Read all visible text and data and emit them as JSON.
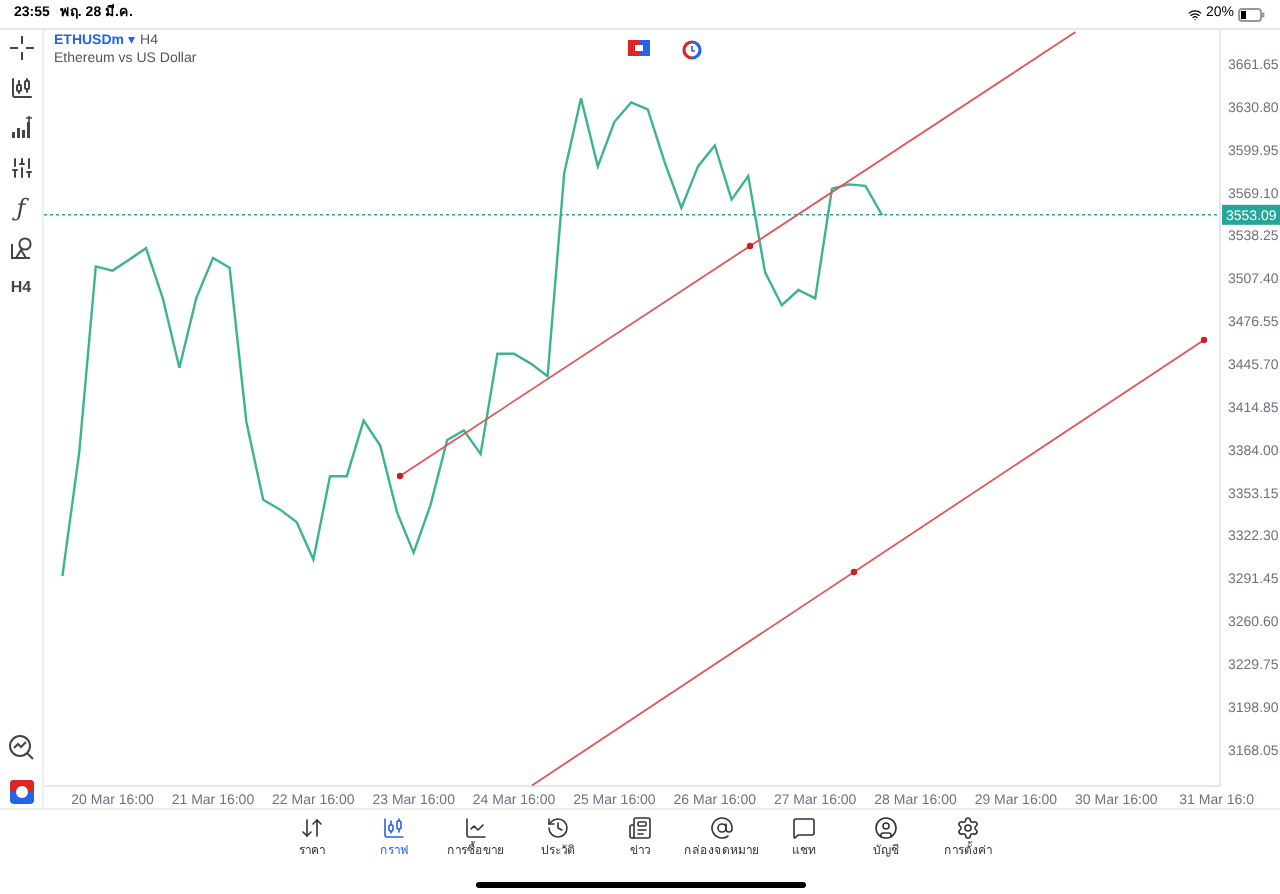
{
  "status_bar": {
    "time": "23:55",
    "date": "พฤ. 28 มี.ค.",
    "battery": "20%"
  },
  "toolbar": {
    "function_label": "ƒ",
    "timeframe": "H4"
  },
  "chart_header": {
    "symbol": "ETHUSDm",
    "marker": "▾",
    "timeframe": "H4",
    "description": "Ethereum vs US Dollar"
  },
  "chart": {
    "chart_data": {
      "type": "line",
      "categories": [
        null,
        null,
        null,
        "20 Mar 16:00",
        null,
        null,
        null,
        null,
        null,
        "21 Mar 16:00",
        null,
        null,
        null,
        null,
        null,
        "22 Mar 16:00",
        null,
        null,
        null,
        null,
        null,
        "23 Mar 16:00",
        null,
        null,
        null,
        null,
        null,
        "24 Mar 16:00",
        null,
        null,
        null,
        null,
        null,
        "25 Mar 16:00",
        null,
        null,
        null,
        null,
        null,
        "26 Mar 16:00",
        null,
        null,
        null,
        null,
        null,
        "27 Mar 16:00",
        null,
        null,
        null,
        null,
        null,
        "28 Mar 16:00",
        null,
        null,
        null,
        null,
        null,
        "29 Mar 16:00",
        null,
        null,
        null,
        null,
        null,
        "30 Mar 16:00",
        null,
        null,
        null,
        null,
        null,
        "31 Mar 16:0"
      ],
      "series": [
        {
          "color": "#3cb58d",
          "values": [
            3293,
            3382,
            3516,
            3513,
            3521,
            3529,
            3493,
            3443,
            3493,
            3522,
            3515,
            3404,
            3348,
            3341,
            3332,
            3305,
            3365,
            3365,
            3405,
            3387,
            3339,
            3310,
            3344,
            3391,
            3398,
            3381,
            3453,
            3453,
            3446,
            3437,
            3583,
            3637,
            3588,
            3620,
            3634,
            3629,
            3591,
            3558,
            3588,
            3603,
            3564,
            3581,
            3512,
            3488,
            3499,
            3493,
            3572,
            3575,
            3574,
            3553,
            null,
            null,
            null,
            null,
            null,
            null,
            null,
            null,
            null,
            null,
            null,
            null,
            null,
            null,
            null,
            null,
            null,
            null,
            null,
            null
          ]
        }
      ],
      "ylim": [
        3142.0,
        3686.1
      ],
      "yticks": [
        {
          "value": 3661.65,
          "label": "3661.65"
        },
        {
          "value": 3630.8,
          "label": "3630.80"
        },
        {
          "value": 3599.95,
          "label": "3599.95"
        },
        {
          "value": 3569.1,
          "label": "3569.10"
        },
        {
          "value": 3538.25,
          "label": "3538.25"
        },
        {
          "value": 3507.4,
          "label": "3507.40"
        },
        {
          "value": 3476.55,
          "label": "3476.55"
        },
        {
          "value": 3445.7,
          "label": "3445.70"
        },
        {
          "value": 3414.85,
          "label": "3414.85"
        },
        {
          "value": 3384.0,
          "label": "3384.00"
        },
        {
          "value": 3353.15,
          "label": "3353.15"
        },
        {
          "value": 3322.3,
          "label": "3322.30"
        },
        {
          "value": 3291.45,
          "label": "3291.45"
        },
        {
          "value": 3260.6,
          "label": "3260.60"
        },
        {
          "value": 3229.75,
          "label": "3229.75"
        },
        {
          "value": 3198.9,
          "label": "3198.90"
        },
        {
          "value": 3168.05,
          "label": "3168.05"
        }
      ],
      "ref_lines": [
        {
          "axis": "y",
          "value": 3553.09,
          "label": "3553.09",
          "color": "#26a69a"
        }
      ]
    }
  },
  "nav": [
    {
      "label": "ราคา",
      "selected": false
    },
    {
      "label": "กราฟ",
      "selected": true
    },
    {
      "label": "การซื้อขาย",
      "selected": false
    },
    {
      "label": "ประวัติ",
      "selected": false
    },
    {
      "label": "ข่าว",
      "selected": false
    },
    {
      "label": "กล่องจดหมาย",
      "selected": false
    },
    {
      "label": "แชท",
      "selected": false
    },
    {
      "label": "บัญชี",
      "selected": false
    },
    {
      "label": "การตั้งค่า",
      "selected": false
    }
  ]
}
